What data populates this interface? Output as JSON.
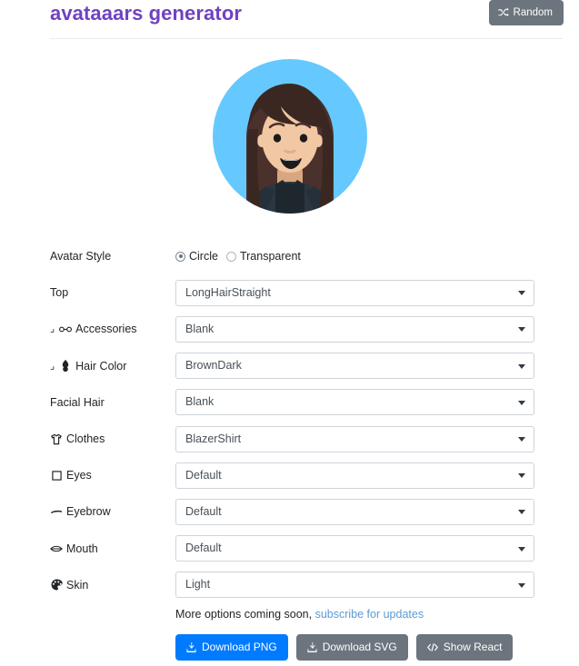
{
  "header": {
    "title": "avataaars generator",
    "random_button": {
      "label": "Random",
      "icon": "shuffle-icon",
      "bg": "#6c757d"
    },
    "title_color": "#6f42c1"
  },
  "avatar": {
    "alt": "avatar-preview",
    "style": "Circle",
    "colors": {
      "background": "#65c9ff",
      "hair": "#4a312c",
      "skin": "#f0c2a0",
      "clothes": "#262e33",
      "mouth": "#000000",
      "eyes": "#000000"
    }
  },
  "form": {
    "avatar_style": {
      "label": "Avatar Style",
      "options": [
        "Circle",
        "Transparent"
      ],
      "selected": "Circle"
    },
    "rows": [
      {
        "label": "Top",
        "icon": null,
        "sub": false,
        "value": "LongHairStraight"
      },
      {
        "label": "Accessories",
        "icon": "glasses-icon",
        "sub": true,
        "value": "Blank"
      },
      {
        "label": "Hair Color",
        "icon": "hair-color-icon",
        "sub": true,
        "value": "BrownDark"
      },
      {
        "label": "Facial Hair",
        "icon": null,
        "sub": false,
        "value": "Blank"
      },
      {
        "label": "Clothes",
        "icon": "tshirt-icon",
        "sub": false,
        "value": "BlazerShirt"
      },
      {
        "label": "Eyes",
        "icon": "eye-square-icon",
        "sub": false,
        "value": "Default"
      },
      {
        "label": "Eyebrow",
        "icon": "eyebrow-icon",
        "sub": false,
        "value": "Default"
      },
      {
        "label": "Mouth",
        "icon": "mouth-icon",
        "sub": false,
        "value": "Default"
      },
      {
        "label": "Skin",
        "icon": "palette-icon",
        "sub": false,
        "value": "Light"
      }
    ]
  },
  "footer": {
    "more_text": "More options coming soon,",
    "subscribe_link": "subscribe for updates",
    "buttons": [
      {
        "label": "Download PNG",
        "icon": "download-icon",
        "style": "primary",
        "bg": "#007bff"
      },
      {
        "label": "Download SVG",
        "icon": "download-icon",
        "style": "secondary",
        "bg": "#6c757d"
      },
      {
        "label": "Show React",
        "icon": "code-icon",
        "style": "secondary",
        "bg": "#6c757d"
      }
    ]
  }
}
